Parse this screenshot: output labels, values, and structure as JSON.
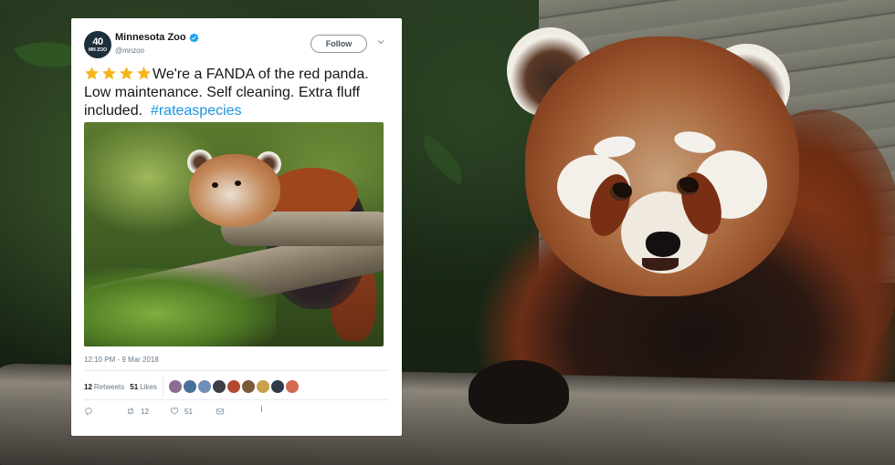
{
  "tweet": {
    "account_name": "Minnesota Zoo",
    "handle": "@mnzoo",
    "avatar_line1": "40",
    "avatar_line2": "MN ZOO",
    "follow_label": "Follow",
    "stars_count": 4,
    "text_main": "We're a FANDA of the red panda. Low maintenance. Self cleaning. Extra fluff included.",
    "hashtag": "#rateaspecies",
    "timestamp": "12:10 PM - 9 Mar 2018",
    "retweets_count": "12",
    "retweets_label": "Retweets",
    "likes_count": "51",
    "likes_label": "Likes",
    "reply_count": "",
    "retweet_action_count": "12",
    "like_action_count": "51"
  },
  "icons": {
    "verified": "verified-badge-icon",
    "chevron": "chevron-down-icon",
    "star": "star-emoji-icon",
    "reply": "reply-icon",
    "retweet": "retweet-icon",
    "like": "heart-icon",
    "message": "envelope-icon"
  },
  "colors": {
    "link": "#1b95e0",
    "verified": "#1da1f2",
    "star": "#f5b51b",
    "muted_text": "#657786",
    "liker_avatars": [
      "#8a6e8f",
      "#4a6f9a",
      "#6f8fb5",
      "#3e3e46",
      "#b04a2e",
      "#7d5a3c",
      "#c9a04a",
      "#2f3a4a",
      "#d46a52"
    ]
  }
}
